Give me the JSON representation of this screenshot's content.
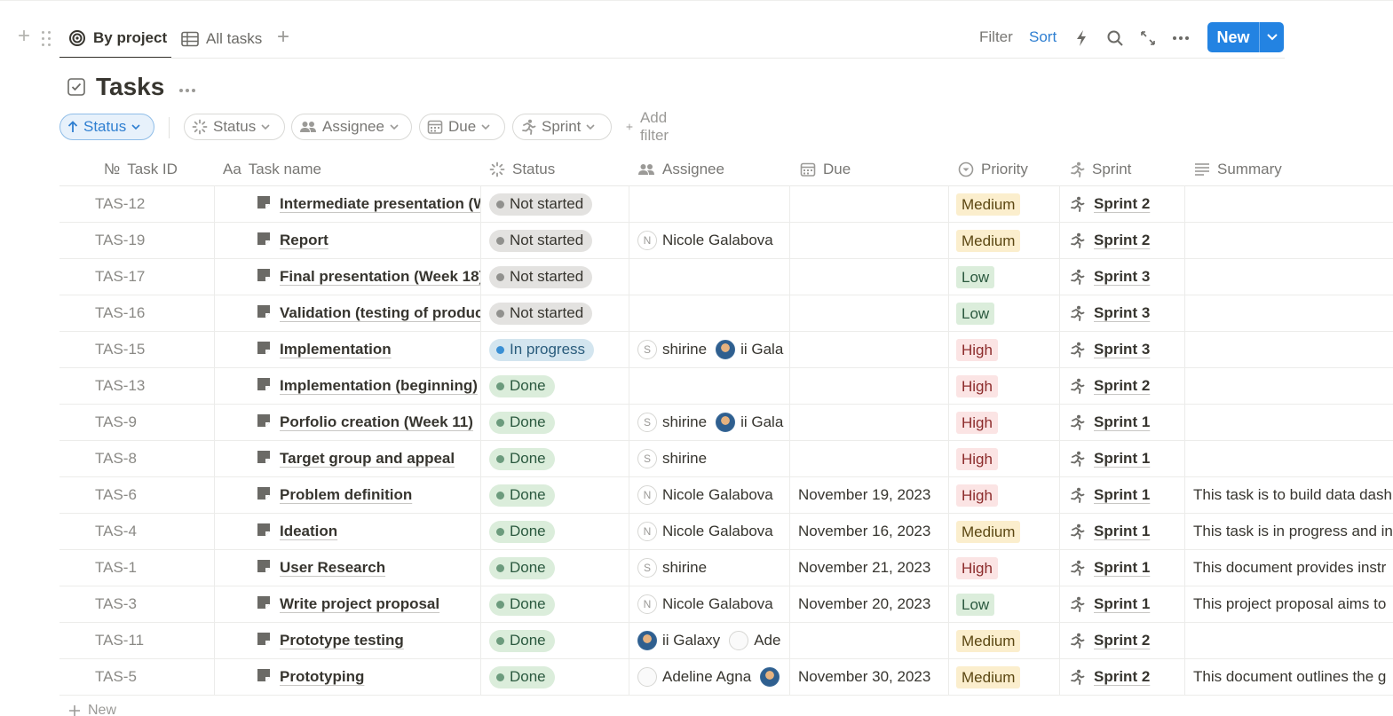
{
  "toolbar": {
    "tabs": [
      {
        "label": "By project",
        "icon": "target-icon"
      },
      {
        "label": "All tasks",
        "icon": "table-icon"
      }
    ],
    "filter_label": "Filter",
    "sort_label": "Sort",
    "new_label": "New"
  },
  "title": "Tasks",
  "filters": {
    "sort_chip": "Status",
    "chips": [
      "Status",
      "Assignee",
      "Due",
      "Sprint"
    ],
    "add_filter": "Add filter"
  },
  "columns": {
    "id": "Task ID",
    "name": "Task name",
    "status": "Status",
    "assignee": "Assignee",
    "due": "Due",
    "priority": "Priority",
    "sprint": "Sprint",
    "summary": "Summary"
  },
  "column_prefix": {
    "id": "№",
    "name": "Aa"
  },
  "rows": [
    {
      "id": "TAS-12",
      "name": "Intermediate presentation (W",
      "status": "Not started",
      "status_kind": "not",
      "assignees": [],
      "due": "",
      "priority": "Medium",
      "sprint": "Sprint 2",
      "summary": ""
    },
    {
      "id": "TAS-19",
      "name": "Report",
      "status": "Not started",
      "status_kind": "not",
      "assignees": [
        {
          "initial": "N",
          "name": "Nicole Galabova",
          "kind": "letter"
        }
      ],
      "due": "",
      "priority": "Medium",
      "sprint": "Sprint 2",
      "summary": ""
    },
    {
      "id": "TAS-17",
      "name": "Final presentation (Week 18)",
      "status": "Not started",
      "status_kind": "not",
      "assignees": [],
      "due": "",
      "priority": "Low",
      "sprint": "Sprint 3",
      "summary": ""
    },
    {
      "id": "TAS-16",
      "name": "Validation (testing of produc",
      "status": "Not started",
      "status_kind": "not",
      "assignees": [],
      "due": "",
      "priority": "Low",
      "sprint": "Sprint 3",
      "summary": ""
    },
    {
      "id": "TAS-15",
      "name": "Implementation",
      "status": "In progress",
      "status_kind": "prog",
      "assignees": [
        {
          "initial": "S",
          "name": "shirine",
          "kind": "letter"
        },
        {
          "initial": "",
          "name": "ii Gala",
          "kind": "img"
        }
      ],
      "due": "",
      "priority": "High",
      "sprint": "Sprint 3",
      "summary": ""
    },
    {
      "id": "TAS-13",
      "name": "Implementation (beginning)",
      "status": "Done",
      "status_kind": "done",
      "assignees": [],
      "due": "",
      "priority": "High",
      "sprint": "Sprint 2",
      "summary": ""
    },
    {
      "id": "TAS-9",
      "name": "Porfolio creation (Week 11)",
      "status": "Done",
      "status_kind": "done",
      "assignees": [
        {
          "initial": "S",
          "name": "shirine",
          "kind": "letter"
        },
        {
          "initial": "",
          "name": "ii Gala",
          "kind": "img"
        }
      ],
      "due": "",
      "priority": "High",
      "sprint": "Sprint 1",
      "summary": ""
    },
    {
      "id": "TAS-8",
      "name": "Target group and appeal",
      "status": "Done",
      "status_kind": "done",
      "assignees": [
        {
          "initial": "S",
          "name": "shirine",
          "kind": "letter"
        }
      ],
      "due": "",
      "priority": "High",
      "sprint": "Sprint 1",
      "summary": ""
    },
    {
      "id": "TAS-6",
      "name": "Problem definition",
      "status": "Done",
      "status_kind": "done",
      "assignees": [
        {
          "initial": "N",
          "name": "Nicole Galabova",
          "kind": "letter"
        }
      ],
      "due": "November 19, 2023",
      "priority": "High",
      "sprint": "Sprint 1",
      "summary": "This task is to build data dash"
    },
    {
      "id": "TAS-4",
      "name": "Ideation",
      "status": "Done",
      "status_kind": "done",
      "assignees": [
        {
          "initial": "N",
          "name": "Nicole Galabova",
          "kind": "letter"
        }
      ],
      "due": "November 16, 2023",
      "priority": "Medium",
      "sprint": "Sprint 1",
      "summary": "This task is in progress and in"
    },
    {
      "id": "TAS-1",
      "name": "User Research",
      "status": "Done",
      "status_kind": "done",
      "assignees": [
        {
          "initial": "S",
          "name": "shirine",
          "kind": "letter"
        }
      ],
      "due": "November 21, 2023",
      "priority": "High",
      "sprint": "Sprint 1",
      "summary": "This document provides instr"
    },
    {
      "id": "TAS-3",
      "name": "Write project proposal",
      "status": "Done",
      "status_kind": "done",
      "assignees": [
        {
          "initial": "N",
          "name": "Nicole Galabova",
          "kind": "letter"
        }
      ],
      "due": "November 20, 2023",
      "priority": "Low",
      "sprint": "Sprint 1",
      "summary": "This project proposal aims to"
    },
    {
      "id": "TAS-11",
      "name": "Prototype testing",
      "status": "Done",
      "status_kind": "done",
      "assignees": [
        {
          "initial": "",
          "name": "ii Galaxy",
          "kind": "img"
        },
        {
          "initial": "",
          "name": "Ade",
          "kind": "blank"
        }
      ],
      "due": "",
      "priority": "Medium",
      "sprint": "Sprint 2",
      "summary": ""
    },
    {
      "id": "TAS-5",
      "name": "Prototyping",
      "status": "Done",
      "status_kind": "done",
      "assignees": [
        {
          "initial": "",
          "name": "Adeline Agna",
          "kind": "blank"
        },
        {
          "initial": "",
          "name": "",
          "kind": "img"
        }
      ],
      "due": "November 30, 2023",
      "priority": "Medium",
      "sprint": "Sprint 2",
      "summary": "This document outlines the g"
    }
  ],
  "new_row_label": "New",
  "colors": {
    "accent": "#2383e2",
    "sort_link": "#2f7fd1"
  }
}
